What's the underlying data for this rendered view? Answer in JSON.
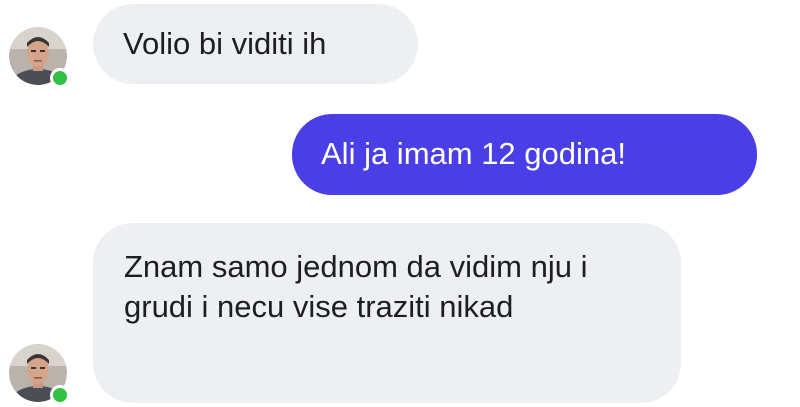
{
  "messages": [
    {
      "direction": "incoming",
      "text": "Volio bi viditi ih"
    },
    {
      "direction": "outgoing",
      "text": "Ali ja imam 12 godina!"
    },
    {
      "direction": "incoming",
      "text": "Znam samo jednom da vidim nju i grudi i necu vise traziti nikad"
    }
  ],
  "contact": {
    "avatar_icon": "user-avatar-photo",
    "online": true,
    "status_color": "#31c244"
  },
  "colors": {
    "incoming_bubble": "#eeeff2",
    "outgoing_bubble": "#4a3ee6",
    "outgoing_text": "#ffffff",
    "incoming_text": "#1c1e21"
  }
}
